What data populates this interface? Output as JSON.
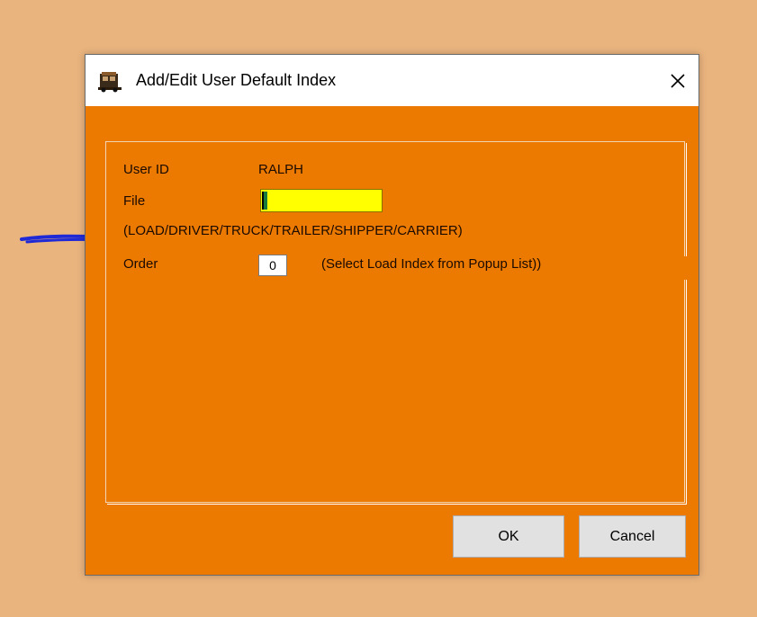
{
  "window": {
    "title": "Add/Edit User Default Index",
    "close_glyph": "✕",
    "app_icon": "truck-app-icon",
    "close_icon": "close-icon"
  },
  "form": {
    "user_id_label": "User ID",
    "user_id_value": "RALPH",
    "file_label": "File",
    "file_value": "",
    "file_hint": "(LOAD/DRIVER/TRUCK/TRAILER/SHIPPER/CARRIER)",
    "order_label": "Order",
    "order_value": "0",
    "order_hint": "(Select Load Index from Popup List))"
  },
  "buttons": {
    "ok_label": "OK",
    "cancel_label": "Cancel"
  },
  "colors": {
    "desktop": "#eab47e",
    "dialog_body": "#ed7a00",
    "file_field": "#ffff00",
    "annotation": "#1f2ad6"
  }
}
